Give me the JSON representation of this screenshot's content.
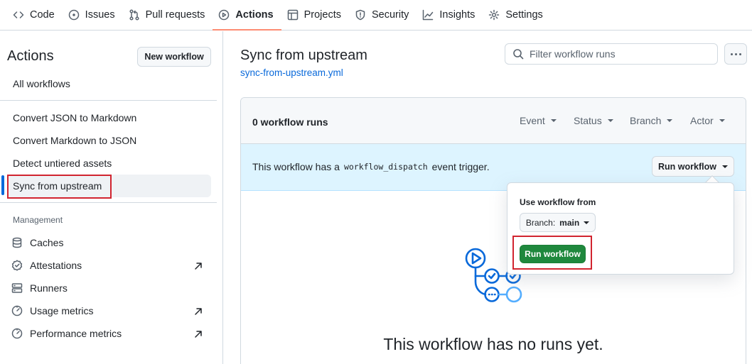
{
  "nav": {
    "tabs": [
      {
        "label": "Code",
        "icon": "code-icon"
      },
      {
        "label": "Issues",
        "icon": "issue-icon"
      },
      {
        "label": "Pull requests",
        "icon": "pull-request-icon"
      },
      {
        "label": "Actions",
        "icon": "play-icon",
        "active": true
      },
      {
        "label": "Projects",
        "icon": "table-icon"
      },
      {
        "label": "Security",
        "icon": "shield-icon"
      },
      {
        "label": "Insights",
        "icon": "graph-icon"
      },
      {
        "label": "Settings",
        "icon": "gear-icon"
      }
    ]
  },
  "sidebar": {
    "title": "Actions",
    "new_workflow": "New workflow",
    "all_workflows": "All workflows",
    "workflows": [
      "Convert JSON to Markdown",
      "Convert Markdown to JSON",
      "Detect untiered assets",
      "Sync from upstream"
    ],
    "management_heading": "Management",
    "management": [
      {
        "label": "Caches",
        "icon": "database-icon"
      },
      {
        "label": "Attestations",
        "icon": "verified-icon",
        "external": true
      },
      {
        "label": "Runners",
        "icon": "server-icon"
      },
      {
        "label": "Usage metrics",
        "icon": "meter-icon",
        "external": true
      },
      {
        "label": "Performance metrics",
        "icon": "meter-icon",
        "external": true
      }
    ]
  },
  "main": {
    "title": "Sync from upstream",
    "file": "sync-from-upstream.yml",
    "filter_placeholder": "Filter workflow runs",
    "runs_count": "0 workflow runs",
    "filters": [
      "Event",
      "Status",
      "Branch",
      "Actor"
    ],
    "dispatch_before": "This workflow has a",
    "dispatch_code": "workflow_dispatch",
    "dispatch_after": "event trigger.",
    "run_workflow_dropdown": "Run workflow",
    "empty_title": "This workflow has no runs yet."
  },
  "popover": {
    "label": "Use workflow from",
    "branch_prefix": "Branch:",
    "branch_name": "main",
    "run_button": "Run workflow"
  },
  "colors": {
    "accent": "#0969da",
    "highlight": "#d1242f",
    "primary_button": "#1f883d",
    "active_tab": "#fd8c73"
  }
}
